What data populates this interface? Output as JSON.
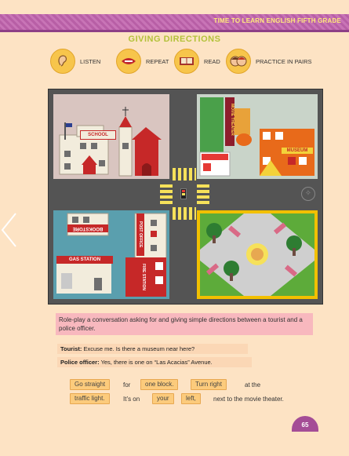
{
  "header": {
    "title": "TIME TO LEARN ENGLISH FIFTH GRADE"
  },
  "page_title": "GIVING DIRECTIONS",
  "actions": [
    {
      "label": "LISTEN",
      "icon": "ear-icon"
    },
    {
      "label": "REPEAT",
      "icon": "mouth-icon"
    },
    {
      "label": "READ",
      "icon": "book-icon"
    },
    {
      "label": "PRACTICE IN PAIRS",
      "icon": "pair-faces-icon"
    }
  ],
  "map": {
    "school": "SCHOOL",
    "movie_theater": "MOVIE THEATER",
    "museum": "MUSEUM",
    "bookstore": "BOOKSTORE",
    "gas_station": "GAS STATION",
    "post_office": "POST OFFICE",
    "fire_station": "FIRE STATION"
  },
  "instructions": "Role-play a conversation asking for and giving simple directions between a tourist and a police officer.",
  "dialogue": {
    "tourist_label": "Tourist:",
    "tourist_line": "Excuse me. Is there a museum near here?",
    "officer_label": "Police officer:",
    "officer_line": "Yes, there is one on “Las Acacias” Avenue."
  },
  "phrases": {
    "go_straight": "Go straight",
    "for": "for",
    "one_block": "one block.",
    "turn_right": "Turn right",
    "at_the": "at the",
    "traffic_light": "traffic light.",
    "its_on": "It’s on",
    "your": "your",
    "left": "left,",
    "next_to": "next to the movie theater."
  },
  "page_number": "65"
}
